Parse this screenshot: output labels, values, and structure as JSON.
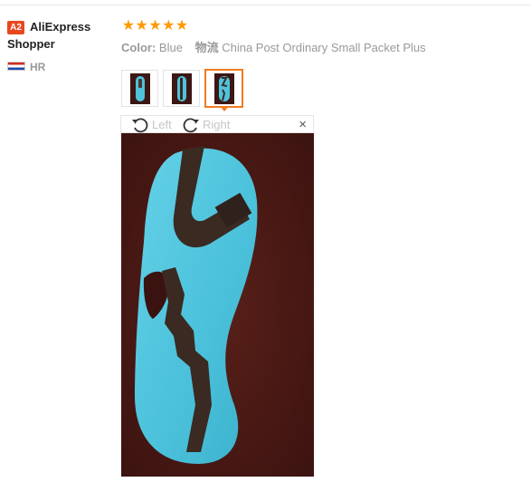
{
  "reviewer": {
    "badge": "A2",
    "name": "AliExpress Shopper",
    "country_code": "HR",
    "flag": "croatia-flag-icon"
  },
  "review": {
    "rating": 5,
    "stars": [
      "★",
      "★",
      "★",
      "★",
      "★"
    ],
    "attributes": [
      {
        "key": "Color:",
        "value": "Blue"
      },
      {
        "key": "物流",
        "value": "China Post Ordinary Small Packet Plus"
      }
    ]
  },
  "gallery": {
    "thumbnail_count": 3,
    "selected_index": 2
  },
  "viewer": {
    "rotate_left_label": "Left",
    "rotate_right_label": "Right",
    "close_label": "×"
  },
  "colors": {
    "star": "#ff9a00",
    "badge": "#e8471f",
    "selected_border": "#f37b1d",
    "mask": "#4fc3dc",
    "background": "#4a1a16",
    "strap": "#3a2a22"
  }
}
